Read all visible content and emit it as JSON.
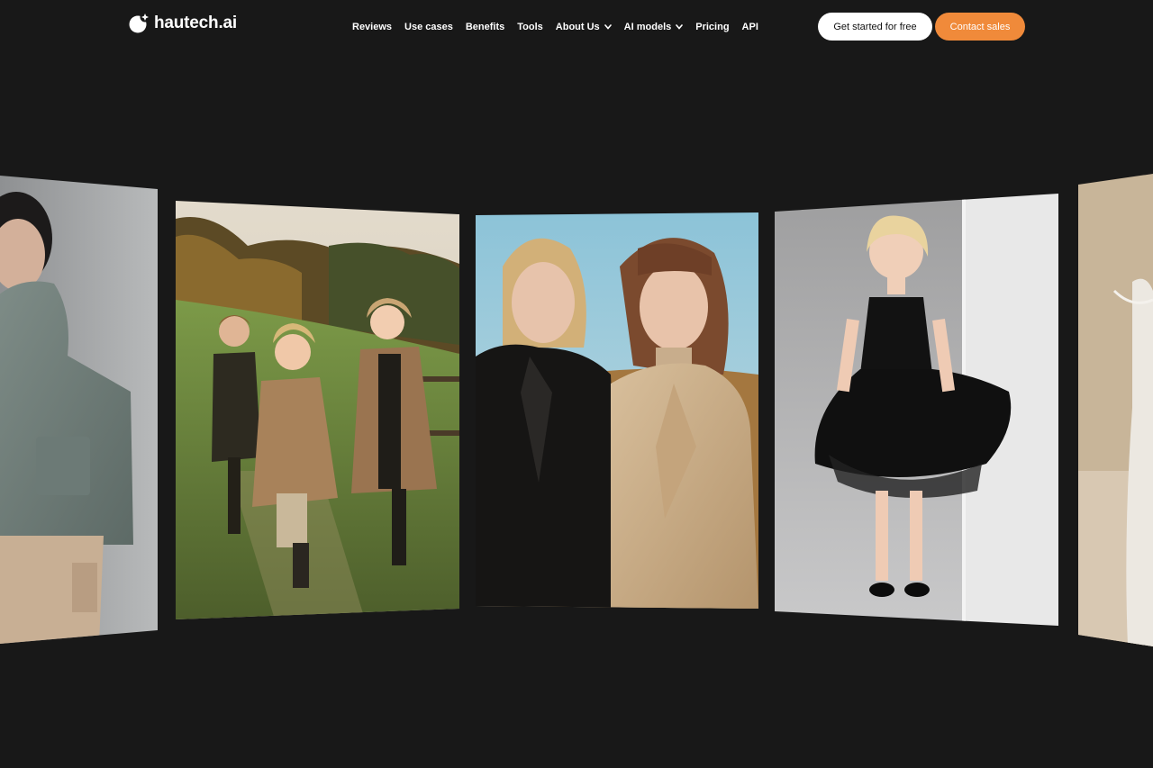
{
  "brand": {
    "name": "hautech.ai",
    "logo_icon": "circle-sparkle-logo"
  },
  "nav": {
    "items": [
      {
        "label": "Reviews",
        "has_dropdown": false
      },
      {
        "label": "Use cases",
        "has_dropdown": false
      },
      {
        "label": "Benefits",
        "has_dropdown": false
      },
      {
        "label": "Tools",
        "has_dropdown": false
      },
      {
        "label": "About Us",
        "has_dropdown": true
      },
      {
        "label": "AI models",
        "has_dropdown": true
      },
      {
        "label": "Pricing",
        "has_dropdown": false
      },
      {
        "label": "API",
        "has_dropdown": false
      }
    ],
    "cta_primary": "Get started for free",
    "cta_secondary": "Contact sales"
  },
  "colors": {
    "background": "#181818",
    "accent": "#f08a3a",
    "button_light": "#ffffff"
  },
  "gallery": {
    "cards": [
      {
        "subject": "woman in sage puffer jacket"
      },
      {
        "subject": "three children running in coats on grassy hill"
      },
      {
        "subject": "two women in black and camel coats"
      },
      {
        "subject": "girl in black tulle dress"
      },
      {
        "subject": "woman in light dress"
      }
    ]
  }
}
